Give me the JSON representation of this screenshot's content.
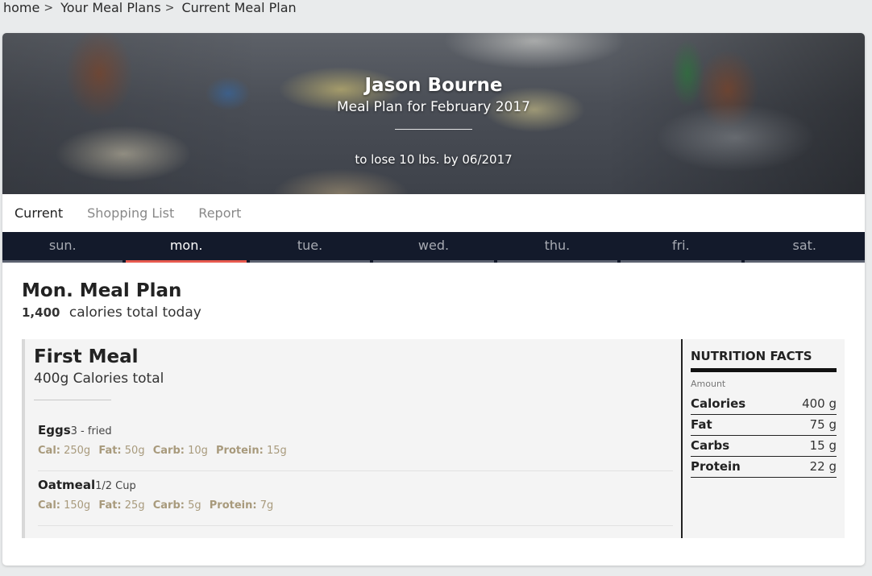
{
  "breadcrumb": {
    "items": [
      "home",
      "Your Meal Plans",
      "Current Meal Plan"
    ],
    "separator": ">"
  },
  "hero": {
    "name": "Jason Bourne",
    "subtitle": "Meal Plan for February 2017",
    "goal": "to lose 10 lbs. by 06/2017"
  },
  "tabs": [
    {
      "label": "Current",
      "active": true
    },
    {
      "label": "Shopping List",
      "active": false
    },
    {
      "label": "Report",
      "active": false
    }
  ],
  "days": [
    {
      "label": "sun.",
      "active": false
    },
    {
      "label": "mon.",
      "active": true
    },
    {
      "label": "tue.",
      "active": false
    },
    {
      "label": "wed.",
      "active": false
    },
    {
      "label": "thu.",
      "active": false
    },
    {
      "label": "fri.",
      "active": false
    },
    {
      "label": "sat.",
      "active": false
    }
  ],
  "plan": {
    "title": "Mon. Meal Plan",
    "calories_value": "1,400",
    "calories_text": "calories total today"
  },
  "meal": {
    "title": "First Meal",
    "subtitle": "400g Calories total",
    "foods": [
      {
        "name": "Eggs",
        "qty": "3 - fried",
        "cal_label": "Cal:",
        "cal": "250g",
        "fat_label": "Fat:",
        "fat": "50g",
        "carb_label": "Carb:",
        "carb": "10g",
        "protein_label": "Protein:",
        "protein": "15g"
      },
      {
        "name": "Oatmeal",
        "qty": "1/2 Cup",
        "cal_label": "Cal:",
        "cal": "150g",
        "fat_label": "Fat:",
        "fat": "25g",
        "carb_label": "Carb:",
        "carb": "5g",
        "protein_label": "Protein:",
        "protein": "7g"
      }
    ]
  },
  "nutrition": {
    "title": "NUTRITION FACTS",
    "amount_label": "Amount",
    "rows": [
      {
        "label": "Calories",
        "value": "400 g"
      },
      {
        "label": "Fat",
        "value": "75 g"
      },
      {
        "label": "Carbs",
        "value": "15 g"
      },
      {
        "label": "Protein",
        "value": "22 g"
      }
    ]
  },
  "colors": {
    "day_bar_bg": "#131a2b",
    "active_day_underline": "#e85a4f",
    "macro_text": "#a89a7c",
    "page_bg": "#e9ebec"
  }
}
